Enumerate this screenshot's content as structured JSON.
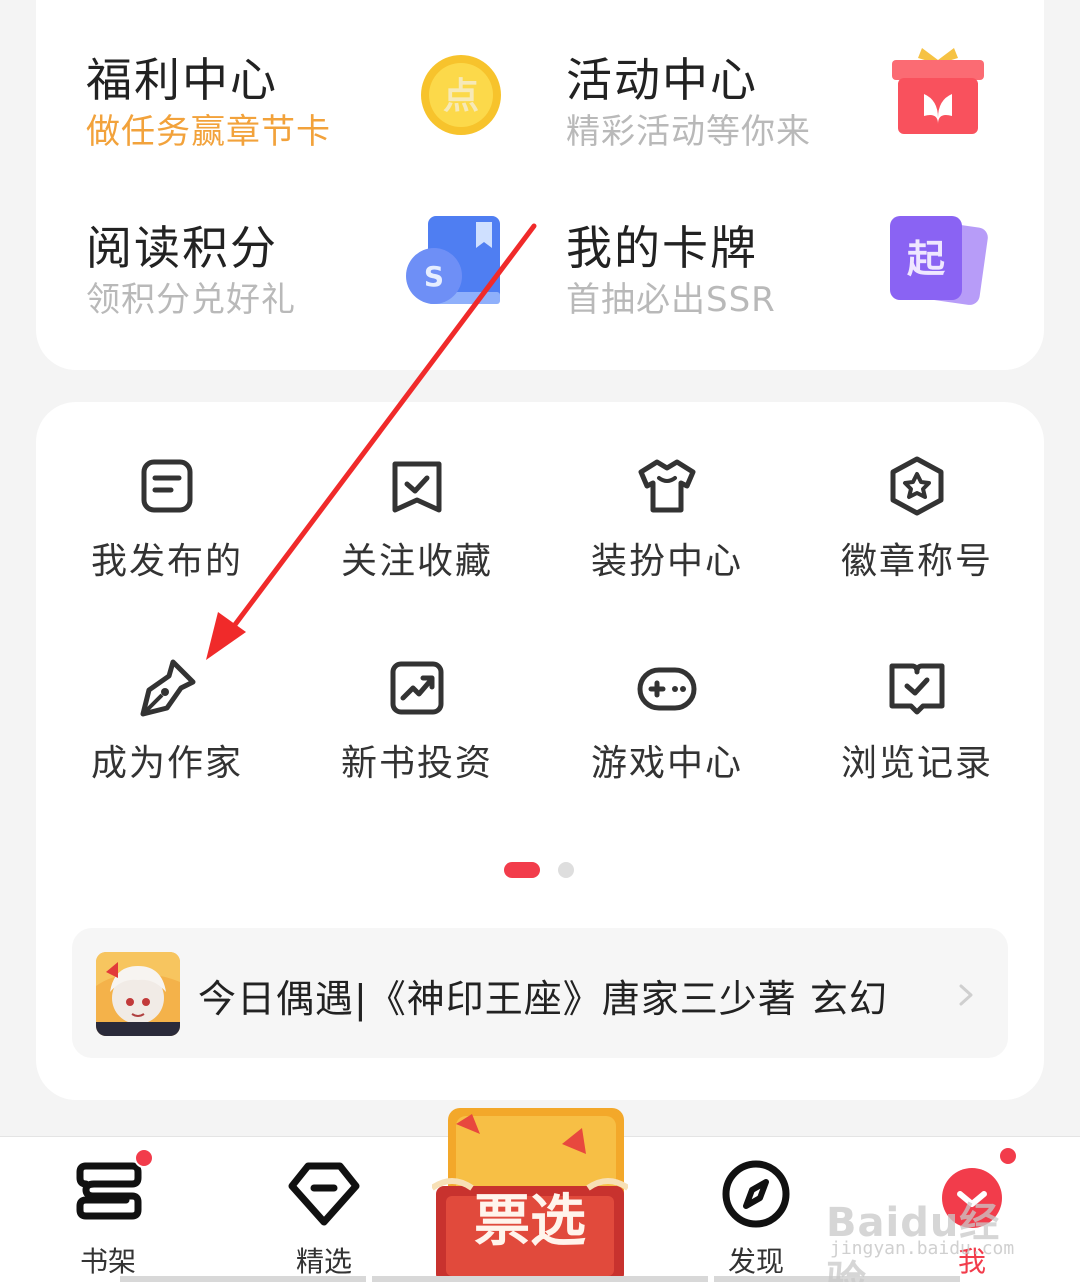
{
  "promos": [
    {
      "title": "福利中心",
      "subtitle": "做任务赢章节卡",
      "icon": "coin-icon",
      "coin_glyph": "点"
    },
    {
      "title": "活动中心",
      "subtitle": "精彩活动等你来",
      "icon": "gift-box-icon"
    },
    {
      "title": "阅读积分",
      "subtitle": "领积分兑好礼",
      "icon": "points-book-icon",
      "coin_glyph": "S"
    },
    {
      "title": "我的卡牌",
      "subtitle": "首抽必出SSR",
      "icon": "cards-icon",
      "card_glyph": "起"
    }
  ],
  "menu": [
    {
      "label": "我发布的",
      "icon": "post-icon"
    },
    {
      "label": "关注收藏",
      "icon": "bookmark-check-icon"
    },
    {
      "label": "装扮中心",
      "icon": "tshirt-icon"
    },
    {
      "label": "徽章称号",
      "icon": "badge-star-icon"
    },
    {
      "label": "成为作家",
      "icon": "pen-nib-icon"
    },
    {
      "label": "新书投资",
      "icon": "trend-chart-icon"
    },
    {
      "label": "游戏中心",
      "icon": "gamepad-icon"
    },
    {
      "label": "浏览记录",
      "icon": "history-book-icon"
    }
  ],
  "pager": {
    "active": 1,
    "total": 2
  },
  "banner": {
    "text": "今日偶遇|《神印王座》唐家三少著 玄幻"
  },
  "tabs": [
    {
      "label": "书架",
      "icon": "bookshelf-icon",
      "has_badge": true
    },
    {
      "label": "精选",
      "icon": "diamond-icon",
      "has_badge": false
    },
    {
      "label": "发现",
      "icon": "compass-icon",
      "has_badge": false
    },
    {
      "label": "我",
      "icon": "profile-icon",
      "has_badge": true
    }
  ],
  "center_tab": {
    "glyphs": "票选"
  },
  "watermark": {
    "brand": "Baidu经验",
    "url": "jingyan.baidu.com"
  },
  "colors": {
    "accent": "#f23c4b",
    "orange": "#f2a23b",
    "arrow": "#f02a2a"
  }
}
